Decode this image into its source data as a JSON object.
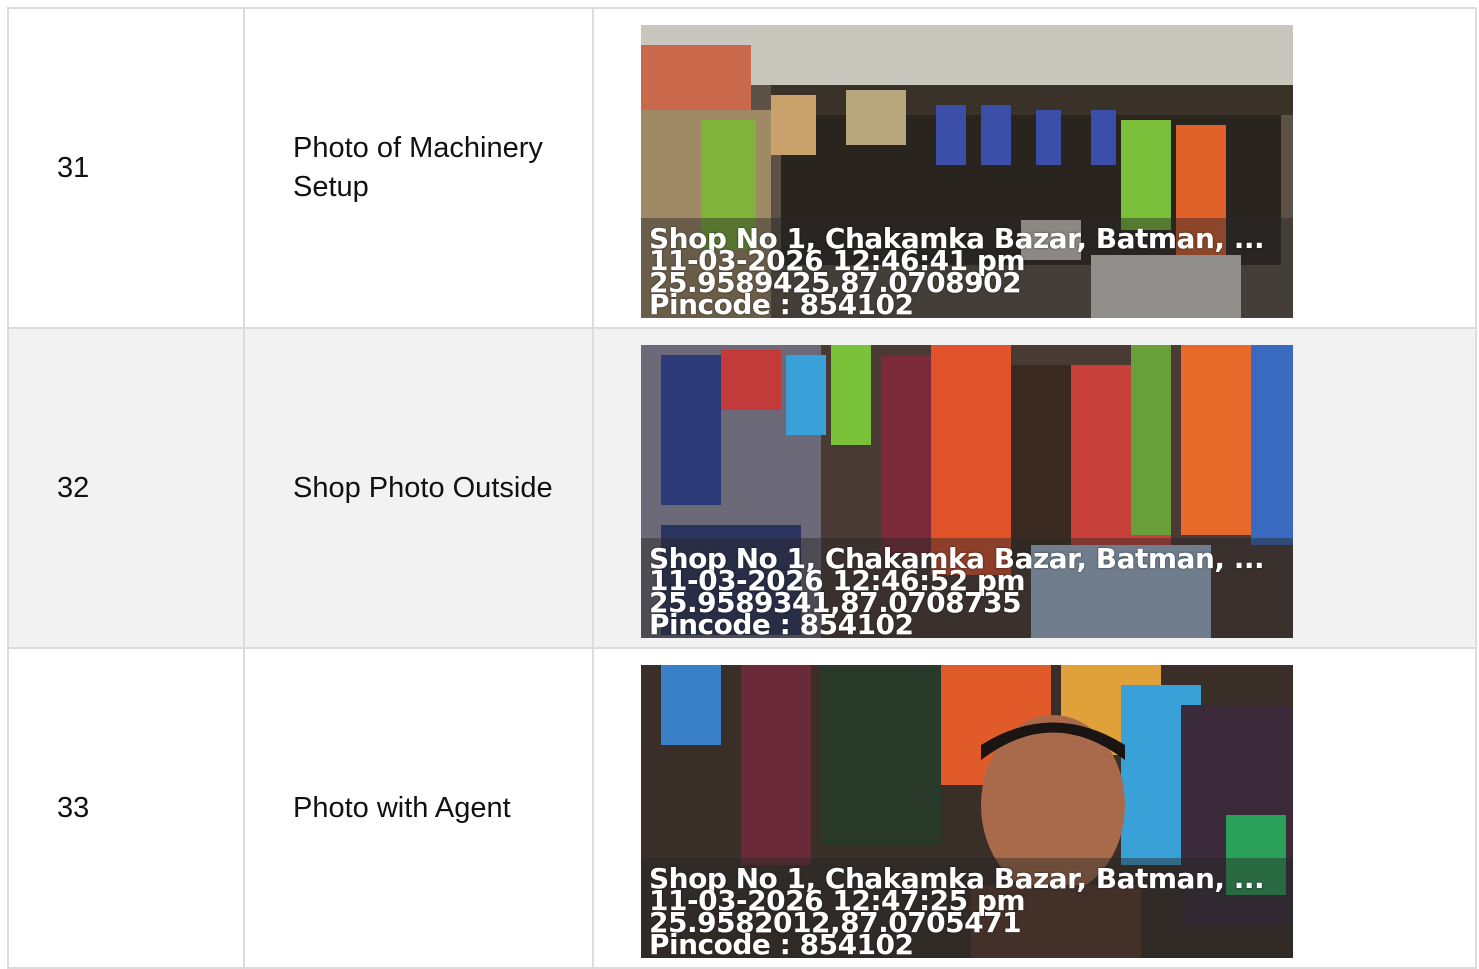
{
  "rows": [
    {
      "number": "31",
      "label": "Photo of Machinery Setup",
      "photo_alt": "shop exterior photo",
      "stamp": {
        "address": "Shop No 1, Chakamka Bazar, Batman, ...",
        "datetime": "11-03-2026 12:46:41 pm",
        "coords": "25.9589425,87.0708902",
        "pincode": "Pincode : 854102"
      }
    },
    {
      "number": "32",
      "label": "Shop Photo Outside",
      "photo_alt": "shop interior shelves photo",
      "stamp": {
        "address": "Shop No 1, Chakamka Bazar, Batman, ...",
        "datetime": "11-03-2026 12:46:52 pm",
        "coords": "25.9589341,87.0708735",
        "pincode": "Pincode : 854102"
      }
    },
    {
      "number": "33",
      "label": "Photo with Agent",
      "photo_alt": "agent selfie in shop photo",
      "stamp": {
        "address": "Shop No 1, Chakamka Bazar, Batman, ...",
        "datetime": "11-03-2026 12:47:25 pm",
        "coords": "25.9582012,87.0705471",
        "pincode": "Pincode : 854102"
      }
    }
  ]
}
